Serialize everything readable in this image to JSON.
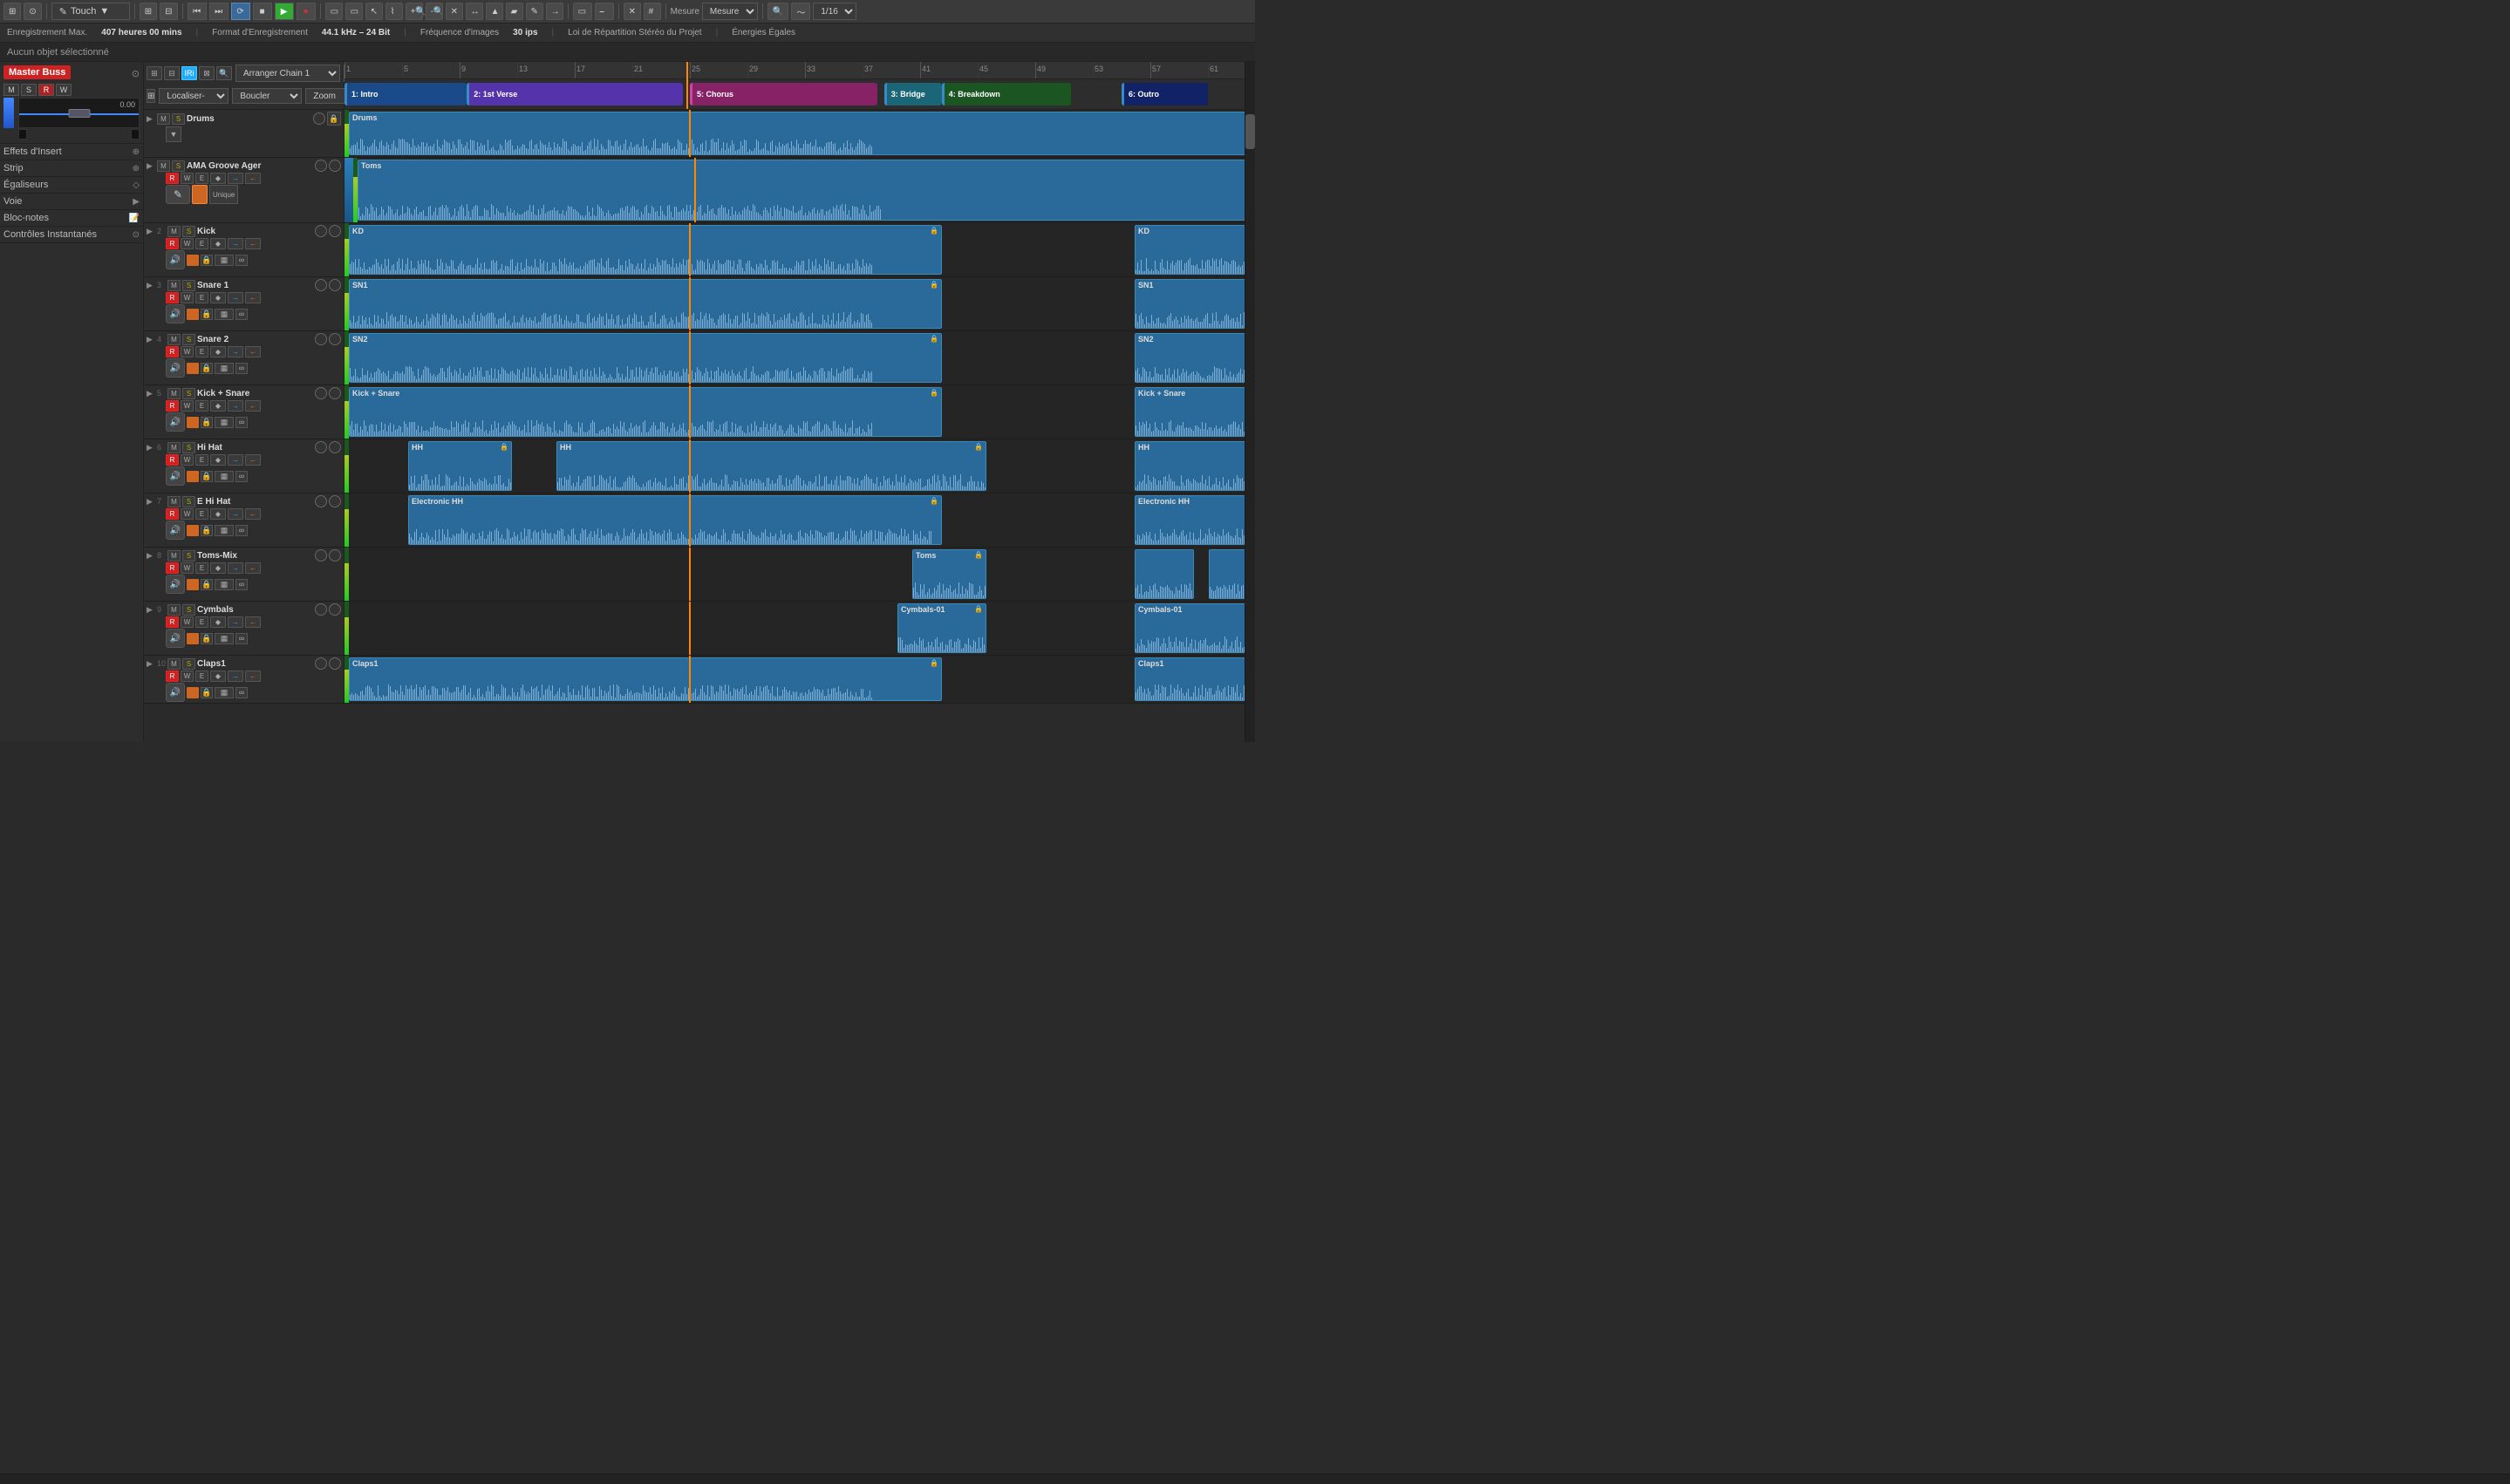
{
  "toolbar": {
    "touch_label": "Touch",
    "mesure_label": "Mesure",
    "quantize_label": "1/16",
    "transport_buttons": [
      "⏮",
      "⏭",
      "⟳",
      "■",
      "▶",
      "⏺"
    ],
    "tool_buttons": [
      "▭",
      "▭",
      "↖",
      "⌇",
      "🔍",
      "🔍",
      "✕",
      "↔",
      "▲",
      "▰",
      "✎",
      "→"
    ]
  },
  "infobar": {
    "enregistrement_max": "Enregistrement Max.",
    "duration": "407 heures 00 mins",
    "format_label": "Format d'Enregistrement",
    "format_value": "44.1 kHz – 24 Bit",
    "frequence_label": "Fréquence d'images",
    "frequence_value": "30 ips",
    "loi_label": "Loi de Répartition Stéréo du Projet",
    "energies_label": "Énergies Égales"
  },
  "statusbar": {
    "text": "Aucun objet sélectionné"
  },
  "left_panel": {
    "master_buss": "Master Buss",
    "fader_value": "0.00",
    "sections": [
      {
        "label": "Effets d'Insert",
        "icon": "⊕"
      },
      {
        "label": "Strip",
        "icon": "⊕"
      },
      {
        "label": "Égaliseurs",
        "icon": "◇"
      },
      {
        "label": "Voie",
        "icon": "▶"
      },
      {
        "label": "Bloc-notes",
        "icon": "📝"
      },
      {
        "label": "Contrôles Instantanés",
        "icon": "⊙"
      }
    ]
  },
  "arranger": {
    "chain_name": "Arranger Chain 1",
    "localiser": "Localiser-",
    "boucler": "Boucler",
    "zoom": "Zoom"
  },
  "ruler": {
    "numbers": [
      1,
      5,
      9,
      13,
      17,
      21,
      25,
      29,
      33,
      37,
      41,
      45,
      49,
      53
    ],
    "positions": [
      0,
      4.5,
      9,
      13.5,
      18,
      22.5,
      27,
      31.5,
      36,
      40.5,
      45,
      49.5,
      54,
      58.5
    ],
    "sections": [
      {
        "label": "1: Intro",
        "start": 0,
        "width": 8.5,
        "color": "blue"
      },
      {
        "label": "2: 1st Verse",
        "start": 8.5,
        "width": 15,
        "color": "purple"
      },
      {
        "label": "3: Bridge",
        "start": 37.5,
        "width": 4,
        "color": "teal"
      },
      {
        "label": "4: Breakdown",
        "start": 41.5,
        "width": 9,
        "color": "green"
      },
      {
        "label": "5: Chorus",
        "start": 24,
        "width": 13,
        "color": "magenta"
      },
      {
        "label": "6: Outro",
        "start": 54,
        "width": 6,
        "color": "dark-blue"
      }
    ]
  },
  "tracks": [
    {
      "num": "",
      "name": "Drums",
      "type": "group",
      "height": 55,
      "clips": [
        {
          "label": "Drums",
          "start": 0,
          "width": 96,
          "color": "teal",
          "locked": false
        }
      ]
    },
    {
      "num": "",
      "name": "AMA Groove Ager",
      "type": "instrument",
      "height": 75,
      "clips": [
        {
          "label": "Toms",
          "start": 0,
          "width": 77.5,
          "color": "teal",
          "locked": false
        }
      ]
    },
    {
      "num": "2",
      "name": "Kick",
      "type": "audio",
      "height": 62,
      "clips": [
        {
          "label": "KD",
          "start": 0,
          "width": 40,
          "color": "teal",
          "locked": true
        },
        {
          "label": "KD",
          "start": 53,
          "width": 20,
          "color": "teal",
          "locked": false
        }
      ]
    },
    {
      "num": "3",
      "name": "Snare 1",
      "type": "audio",
      "height": 62,
      "clips": [
        {
          "label": "SN1",
          "start": 0,
          "width": 40,
          "color": "teal",
          "locked": true
        },
        {
          "label": "SN1",
          "start": 53,
          "width": 18,
          "color": "teal",
          "locked": false
        }
      ]
    },
    {
      "num": "4",
      "name": "Snare 2",
      "type": "audio",
      "height": 62,
      "clips": [
        {
          "label": "SN2",
          "start": 0,
          "width": 40,
          "color": "teal",
          "locked": true
        },
        {
          "label": "SN2",
          "start": 53,
          "width": 18,
          "color": "teal",
          "locked": false
        }
      ]
    },
    {
      "num": "5",
      "name": "Kick + Snare",
      "type": "audio",
      "height": 62,
      "clips": [
        {
          "label": "Kick + Snare",
          "start": 0,
          "width": 40,
          "color": "teal",
          "locked": true
        },
        {
          "label": "Kick + Snare",
          "start": 53,
          "width": 20,
          "color": "teal",
          "locked": false
        }
      ]
    },
    {
      "num": "6",
      "name": "Hi Hat",
      "type": "audio",
      "height": 62,
      "clips": [
        {
          "label": "HH",
          "start": 4,
          "width": 7,
          "color": "teal",
          "locked": true
        },
        {
          "label": "HH",
          "start": 14,
          "width": 29,
          "color": "teal",
          "locked": true
        },
        {
          "label": "HH",
          "start": 53,
          "width": 19,
          "color": "teal",
          "locked": false
        }
      ]
    },
    {
      "num": "7",
      "name": "E Hi Hat",
      "type": "audio",
      "height": 62,
      "clips": [
        {
          "label": "Electronic HH",
          "start": 4,
          "width": 36,
          "color": "teal",
          "locked": true
        },
        {
          "label": "Electronic HH",
          "start": 53,
          "width": 18,
          "color": "teal",
          "locked": false
        }
      ]
    },
    {
      "num": "8",
      "name": "Toms-Mix",
      "type": "audio",
      "height": 62,
      "clips": [
        {
          "label": "Toms",
          "start": 38,
          "width": 5,
          "color": "teal",
          "locked": true
        },
        {
          "label": "",
          "start": 53,
          "width": 4,
          "color": "teal",
          "locked": false
        },
        {
          "label": "",
          "start": 58,
          "width": 4,
          "color": "teal",
          "locked": false
        }
      ]
    },
    {
      "num": "9",
      "name": "Cymbals",
      "type": "audio",
      "height": 62,
      "clips": [
        {
          "label": "Cymbals-01",
          "start": 37,
          "width": 6,
          "color": "teal",
          "locked": true
        },
        {
          "label": "Cymbals-01",
          "start": 53,
          "width": 18,
          "color": "teal",
          "locked": false
        }
      ]
    },
    {
      "num": "10",
      "name": "Claps1",
      "type": "audio",
      "height": 55,
      "clips": [
        {
          "label": "Claps1",
          "start": 0,
          "width": 40,
          "color": "teal",
          "locked": true
        },
        {
          "label": "Claps1",
          "start": 53,
          "width": 18,
          "color": "teal",
          "locked": false
        }
      ]
    }
  ],
  "playhead_position": "37.5",
  "icons": {
    "drums": "🥁",
    "groove_ager": "🎹",
    "kick": "🔊",
    "snare": "🥁",
    "hihat": "🎵",
    "cymbal": "🎵",
    "clap": "👏"
  }
}
